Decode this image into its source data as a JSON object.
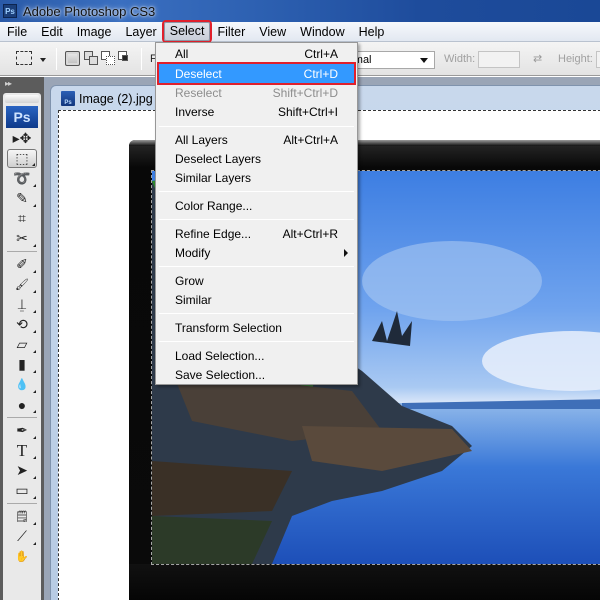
{
  "app": {
    "title": "Adobe Photoshop CS3",
    "logo_text": "Ps"
  },
  "menubar": {
    "items": [
      {
        "label": "File"
      },
      {
        "label": "Edit"
      },
      {
        "label": "Image"
      },
      {
        "label": "Layer"
      },
      {
        "label": "Select",
        "open": true
      },
      {
        "label": "Filter"
      },
      {
        "label": "View"
      },
      {
        "label": "Window"
      },
      {
        "label": "Help"
      }
    ]
  },
  "options_bar": {
    "tool_icon": "rectangular-marquee-icon",
    "selection_modes": [
      "new-selection",
      "add-to-selection",
      "subtract-from-selection",
      "intersect-with-selection"
    ],
    "feather_label_partial": "F",
    "style_value_partial": "ormal",
    "width_label": "Width:",
    "width_value": "",
    "height_label": "Height:",
    "height_value": ""
  },
  "tools_panel": {
    "badge": "Ps",
    "tools": [
      {
        "name": "move",
        "glyph": "▸✥"
      },
      {
        "name": "rectangular-marquee",
        "glyph": "⬚",
        "active": true
      },
      {
        "name": "lasso",
        "glyph": "➰"
      },
      {
        "name": "quick-selection",
        "glyph": "✎"
      },
      {
        "name": "crop",
        "glyph": "⌗"
      },
      {
        "name": "slice",
        "glyph": "✂"
      },
      {
        "name": "spot-healing-brush",
        "glyph": "✐"
      },
      {
        "name": "brush",
        "glyph": "🖌"
      },
      {
        "name": "clone-stamp",
        "glyph": "⍊"
      },
      {
        "name": "history-brush",
        "glyph": "⟲"
      },
      {
        "name": "eraser",
        "glyph": "▱"
      },
      {
        "name": "gradient",
        "glyph": "▮"
      },
      {
        "name": "blur",
        "glyph": "💧"
      },
      {
        "name": "dodge",
        "glyph": "●"
      },
      {
        "name": "pen",
        "glyph": "✒"
      },
      {
        "name": "type",
        "glyph": "T"
      },
      {
        "name": "path-selection",
        "glyph": "➤"
      },
      {
        "name": "rectangle",
        "glyph": "▭"
      },
      {
        "name": "notes",
        "glyph": "🗒"
      },
      {
        "name": "eyedropper",
        "glyph": "⟋"
      },
      {
        "name": "hand",
        "glyph": "✋"
      }
    ]
  },
  "document": {
    "title": "Image (2).jpg"
  },
  "select_menu": {
    "items": [
      {
        "label": "All",
        "shortcut": "Ctrl+A"
      },
      {
        "label": "Deselect",
        "shortcut": "Ctrl+D",
        "highlighted": true
      },
      {
        "label": "Reselect",
        "shortcut": "Shift+Ctrl+D",
        "disabled": true
      },
      {
        "label": "Inverse",
        "shortcut": "Shift+Ctrl+I"
      },
      {
        "separator": true
      },
      {
        "label": "All Layers",
        "shortcut": "Alt+Ctrl+A"
      },
      {
        "label": "Deselect Layers",
        "shortcut": ""
      },
      {
        "label": "Similar Layers",
        "shortcut": ""
      },
      {
        "separator": true
      },
      {
        "label": "Color Range...",
        "shortcut": ""
      },
      {
        "separator": true
      },
      {
        "label": "Refine Edge...",
        "shortcut": "Alt+Ctrl+R"
      },
      {
        "label": "Modify",
        "shortcut": "",
        "submenu": true
      },
      {
        "separator": true
      },
      {
        "label": "Grow",
        "shortcut": ""
      },
      {
        "label": "Similar",
        "shortcut": ""
      },
      {
        "separator": true
      },
      {
        "label": "Transform Selection",
        "shortcut": ""
      },
      {
        "separator": true
      },
      {
        "label": "Load Selection...",
        "shortcut": ""
      },
      {
        "label": "Save Selection...",
        "shortcut": ""
      }
    ]
  },
  "colors": {
    "highlight": "#3399ff",
    "annotation_red": "#e0202c",
    "titlebar_blue": "#2a5aa8"
  }
}
